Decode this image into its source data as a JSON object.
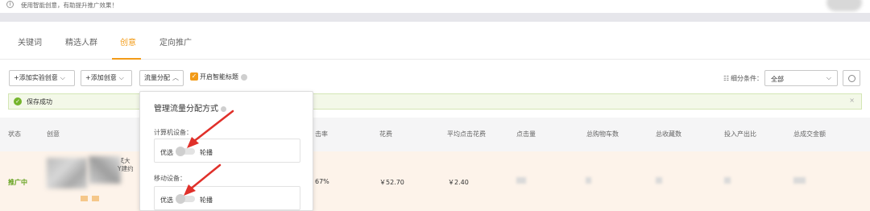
{
  "info_bar": {
    "icon": "info-icon",
    "text": "使用智能创意，有助提升推广效果！"
  },
  "tabs": [
    {
      "label": "关键词",
      "active": false
    },
    {
      "label": "精选人群",
      "active": false
    },
    {
      "label": "创意",
      "active": true
    },
    {
      "label": "定向推广",
      "active": false
    }
  ],
  "toolbar": {
    "add_experiment_label": "+添加实验创意",
    "add_creative_label": "+添加创意",
    "traffic_label": "流量分配",
    "smart_title_label": "开启智能标题",
    "smart_title_checked": true,
    "filter_label": "细分条件：",
    "filter_value": "全部"
  },
  "notice": {
    "text": "保存成功"
  },
  "popover": {
    "title": "管理流量分配方式",
    "sections": [
      {
        "label": "计算机设备：",
        "left": "优选",
        "right": "轮播"
      },
      {
        "label": "移动设备：",
        "left": "优选",
        "right": "轮播"
      }
    ]
  },
  "table": {
    "headers": [
      "状态",
      "创意",
      "击率",
      "花费",
      "平均点击花费",
      "点击量",
      "总购物车数",
      "总收藏数",
      "投入产出比",
      "总成交金额"
    ],
    "row": {
      "status": "推广中",
      "snippet_1": "ξ大",
      "snippet_2": "Y建约",
      "ctr": "67%",
      "cost": "￥52.70",
      "avg_cpc": "￥2.40"
    }
  },
  "colors": {
    "accent": "#f29b18",
    "success": "#75b52c",
    "arrow": "#e0302a"
  }
}
